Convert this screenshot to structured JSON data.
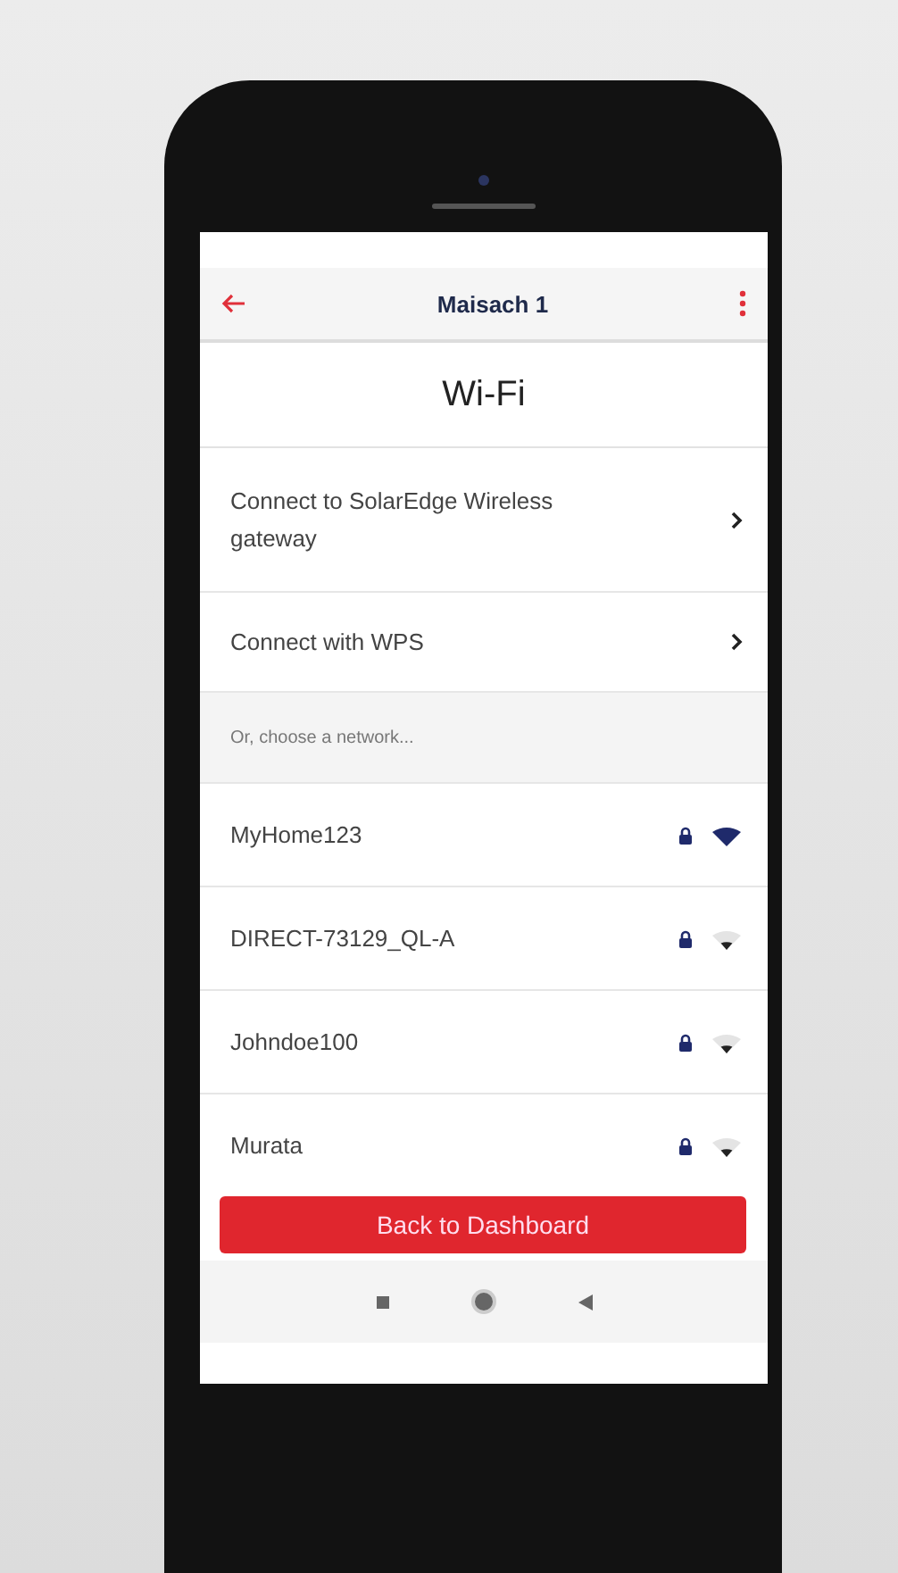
{
  "app_bar": {
    "title": "Maisach 1"
  },
  "page_title": "Wi-Fi",
  "options": [
    {
      "label": "Connect to SolarEdge Wireless gateway"
    },
    {
      "label": "Connect with WPS"
    }
  ],
  "section_hint": "Or, choose a network...",
  "networks": [
    {
      "name": "MyHome123",
      "locked": true,
      "kind": "strong"
    },
    {
      "name": "DIRECT-73129_QL-A",
      "locked": true,
      "kind": "weak"
    },
    {
      "name": "Johndoe100",
      "locked": true,
      "kind": "weak"
    },
    {
      "name": "Murata",
      "locked": true,
      "kind": "weak"
    }
  ],
  "primary_button": "Back to Dashboard"
}
